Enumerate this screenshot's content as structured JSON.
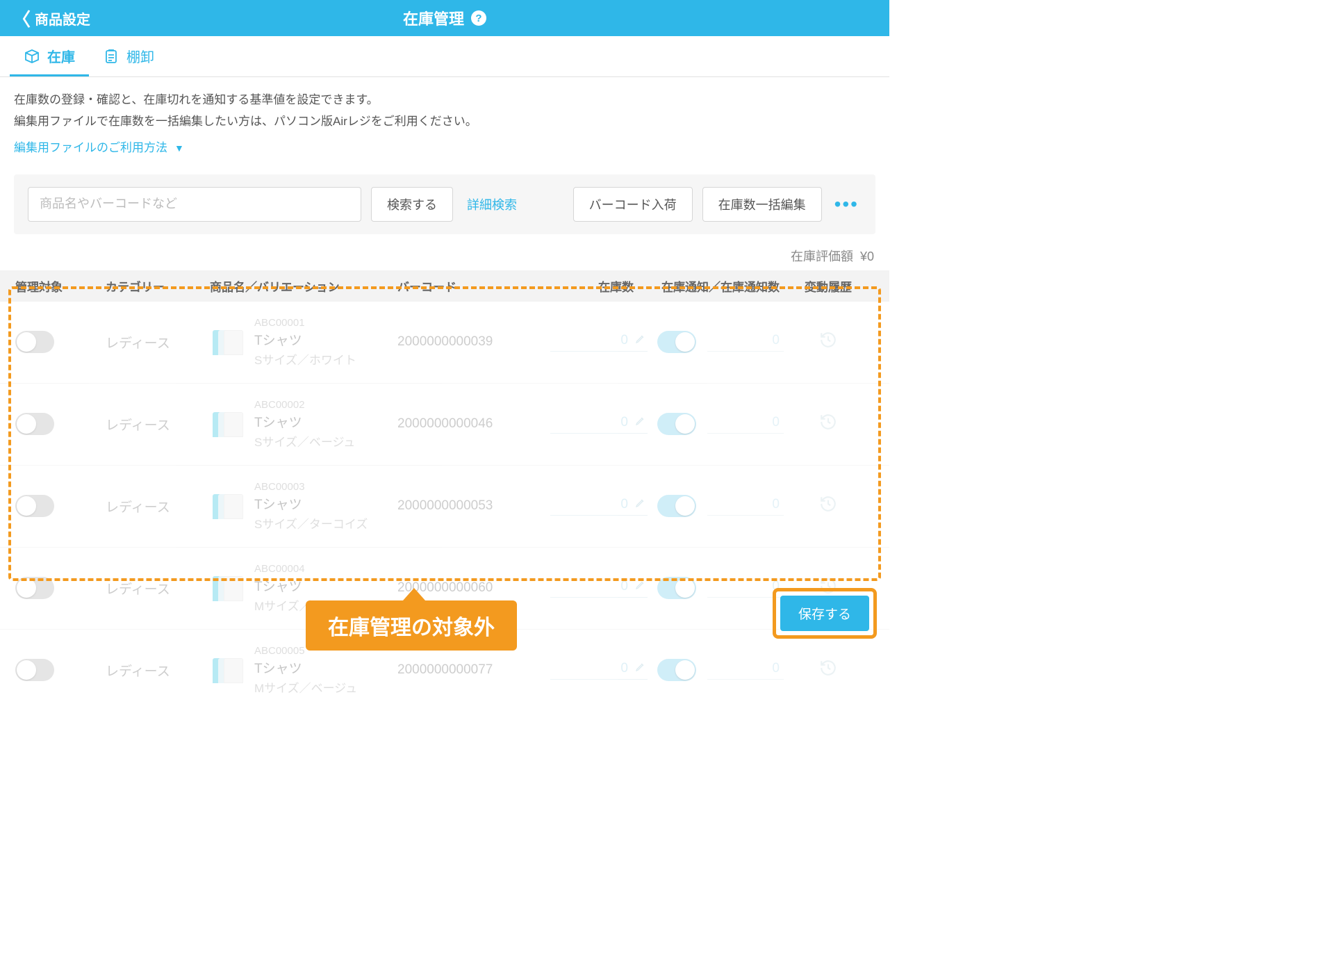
{
  "header": {
    "back_label": "商品設定",
    "title": "在庫管理"
  },
  "tabs": {
    "stock": "在庫",
    "inventory": "棚卸"
  },
  "info": {
    "line1": "在庫数の登録・確認と、在庫切れを通知する基準値を設定できます。",
    "line2": "編集用ファイルで在庫数を一括編集したい方は、パソコン版Airレジをご利用ください。",
    "link": "編集用ファイルのご利用方法"
  },
  "search": {
    "placeholder": "商品名やバーコードなど",
    "search_btn": "検索する",
    "advanced": "詳細検索",
    "barcode_btn": "バーコード入荷",
    "bulk_btn": "在庫数一括編集"
  },
  "valuation": {
    "label": "在庫評価額",
    "value": "¥0"
  },
  "columns": {
    "target": "管理対象",
    "category": "カテゴリー",
    "product": "商品名／バリエーション",
    "barcode": "バーコード",
    "stock": "在庫数",
    "notify": "在庫通知／在庫通知数",
    "history": "変動履歴"
  },
  "rows": [
    {
      "category": "レディース",
      "code": "ABC00001",
      "name": "Tシャツ",
      "variant": "Sサイズ／ホワイト",
      "barcode": "2000000000039",
      "stock": "0",
      "notify_on": true,
      "notify_val": "0"
    },
    {
      "category": "レディース",
      "code": "ABC00002",
      "name": "Tシャツ",
      "variant": "Sサイズ／ベージュ",
      "barcode": "2000000000046",
      "stock": "0",
      "notify_on": true,
      "notify_val": "0"
    },
    {
      "category": "レディース",
      "code": "ABC00003",
      "name": "Tシャツ",
      "variant": "Sサイズ／ターコイズ",
      "barcode": "2000000000053",
      "stock": "0",
      "notify_on": true,
      "notify_val": "0"
    },
    {
      "category": "レディース",
      "code": "ABC00004",
      "name": "Tシャツ",
      "variant": "Mサイズ／ホワイト",
      "barcode": "2000000000060",
      "stock": "0",
      "notify_on": true,
      "notify_val": "0"
    },
    {
      "category": "レディース",
      "code": "ABC00005",
      "name": "Tシャツ",
      "variant": "Mサイズ／ベージュ",
      "barcode": "2000000000077",
      "stock": "0",
      "notify_on": true,
      "notify_val": "0"
    }
  ],
  "callout": "在庫管理の対象外",
  "save": "保存する"
}
